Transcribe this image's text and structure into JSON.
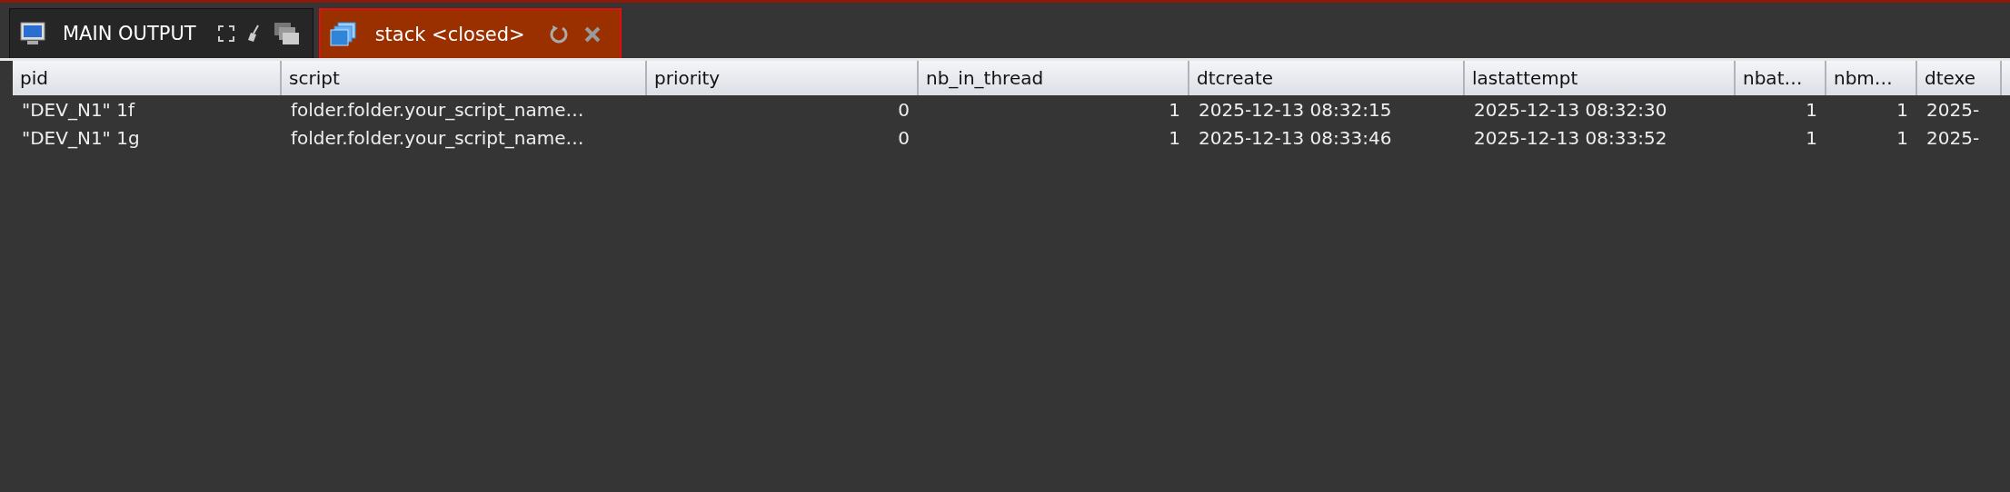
{
  "tabs": [
    {
      "label": "MAIN OUTPUT",
      "selected": false,
      "kind": "output"
    },
    {
      "label": "stack <closed>",
      "selected": true,
      "kind": "stack"
    }
  ],
  "table": {
    "columns": [
      {
        "label": "pid",
        "kind": "text"
      },
      {
        "label": "script",
        "kind": "text"
      },
      {
        "label": "priority",
        "kind": "number"
      },
      {
        "label": "nb_in_thread",
        "kind": "number"
      },
      {
        "label": "dtcreate",
        "kind": "text"
      },
      {
        "label": "lastattempt",
        "kind": "text"
      },
      {
        "label": "nbat…",
        "kind": "number"
      },
      {
        "label": "nbm…",
        "kind": "number"
      },
      {
        "label": "dtexe",
        "kind": "text"
      }
    ],
    "rows": [
      [
        "\"DEV_N1\" 1f",
        "folder.folder.your_script_name…",
        "0",
        "1",
        "2025-12-13 08:32:15",
        "2025-12-13 08:32:30",
        "1",
        "1",
        "2025-"
      ],
      [
        "\"DEV_N1\" 1g",
        "folder.folder.your_script_name…",
        "0",
        "1",
        "2025-12-13 08:33:46",
        "2025-12-13 08:33:52",
        "1",
        "1",
        "2025-"
      ]
    ]
  }
}
